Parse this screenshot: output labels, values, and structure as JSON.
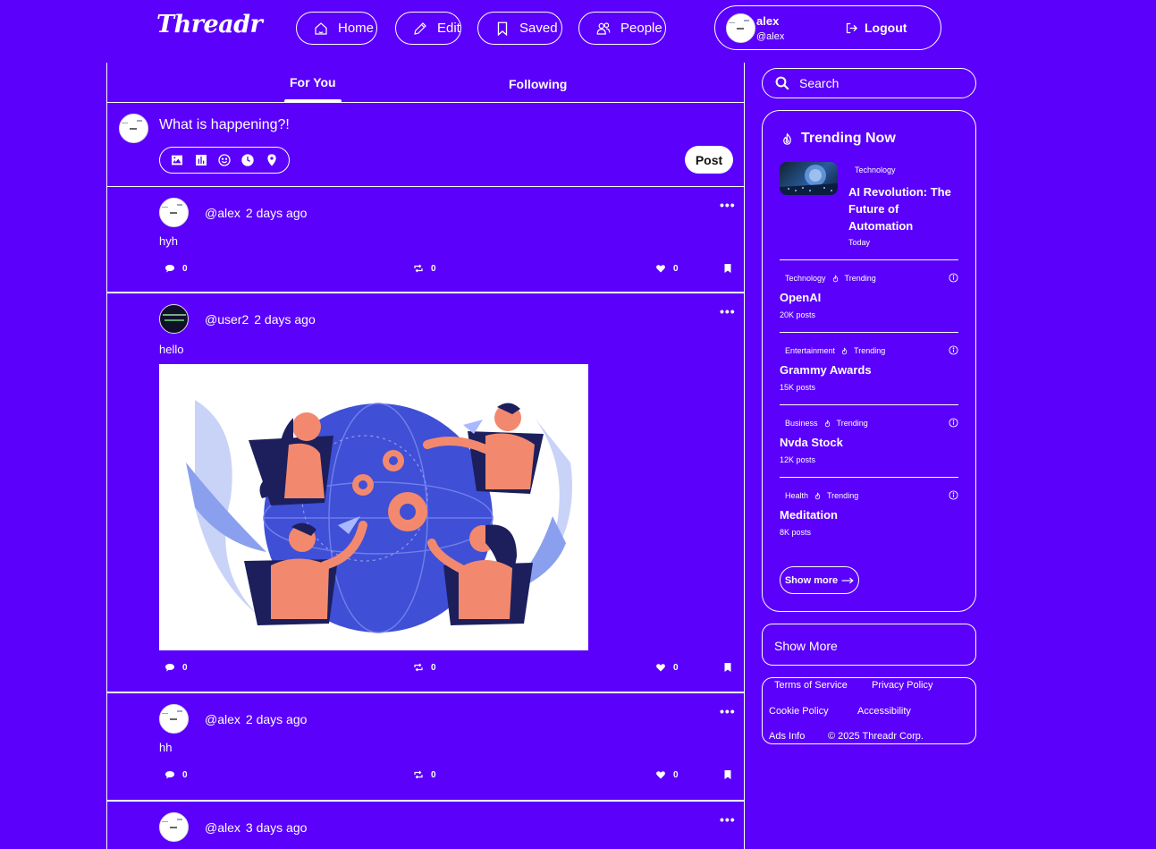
{
  "app": {
    "logo": "Threadr"
  },
  "nav": {
    "home": "Home",
    "edit": "Edit",
    "saved": "Saved",
    "people": "People"
  },
  "user": {
    "name": "alex",
    "handle": "@alex",
    "logout": "Logout"
  },
  "feed": {
    "tabs": [
      {
        "label": "For You",
        "active": true
      },
      {
        "label": "Following",
        "active": false
      }
    ],
    "composer": {
      "placeholder": "What is happening?!",
      "post_label": "Post"
    },
    "posts": [
      {
        "handle": "@alex",
        "time": "2 days ago",
        "text": "hyh",
        "comments": "0",
        "reposts": "0",
        "likes": "0"
      },
      {
        "handle": "@user2",
        "time": "2 days ago",
        "text": "hello",
        "comments": "0",
        "reposts": "0",
        "likes": "0",
        "has_image": true
      },
      {
        "handle": "@alex",
        "time": "2 days ago",
        "text": "hh",
        "comments": "0",
        "reposts": "0",
        "likes": "0"
      },
      {
        "handle": "@alex",
        "time": "3 days ago"
      }
    ],
    "more_icon": "ellipsis-icon"
  },
  "sidebar": {
    "search_placeholder": "Search",
    "trending": {
      "title": "Trending Now",
      "featured": {
        "category": "Technology",
        "title": "AI Revolution: The Future of Automation",
        "date": "Today"
      },
      "tag": "Trending",
      "items": [
        {
          "category": "Technology",
          "name": "OpenAI",
          "count": "20K posts"
        },
        {
          "category": "Entertainment",
          "name": "Grammy Awards",
          "count": "15K posts"
        },
        {
          "category": "Business",
          "name": "Nvda Stock",
          "count": "12K posts"
        },
        {
          "category": "Health",
          "name": "Meditation",
          "count": "8K posts"
        }
      ],
      "show_more": "Show more"
    },
    "show_more_box": "Show More",
    "footer": {
      "terms": "Terms of Service",
      "privacy": "Privacy Policy",
      "cookie": "Cookie Policy",
      "accessibility": "Accessibility",
      "ads": "Ads Info",
      "copyright": "© 2025 Threadr Corp."
    }
  },
  "colors": {
    "background": "#5a00fb",
    "foreground": "#ffffff"
  }
}
